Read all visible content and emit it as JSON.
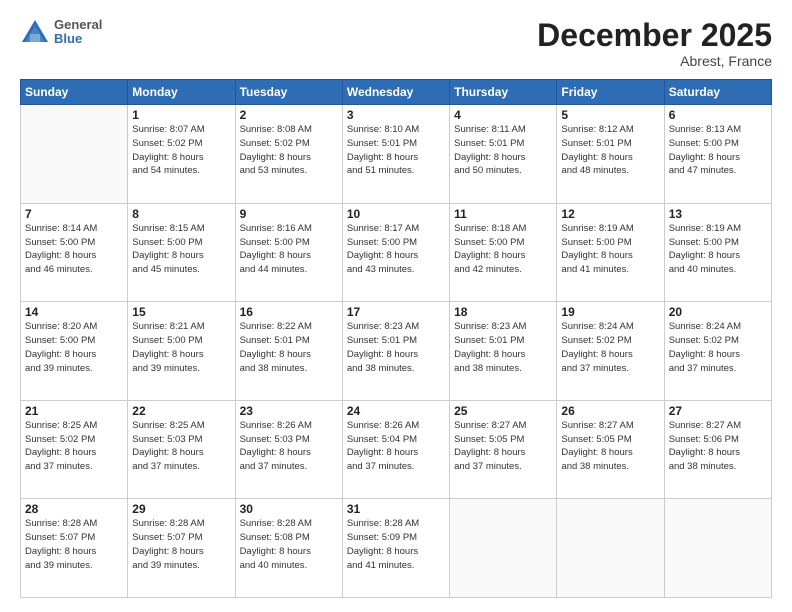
{
  "logo": {
    "general": "General",
    "blue": "Blue"
  },
  "title": "December 2025",
  "subtitle": "Abrest, France",
  "days_of_week": [
    "Sunday",
    "Monday",
    "Tuesday",
    "Wednesday",
    "Thursday",
    "Friday",
    "Saturday"
  ],
  "weeks": [
    [
      {
        "day": "",
        "sunrise": "",
        "sunset": "",
        "daylight": ""
      },
      {
        "day": "1",
        "sunrise": "Sunrise: 8:07 AM",
        "sunset": "Sunset: 5:02 PM",
        "daylight": "Daylight: 8 hours and 54 minutes."
      },
      {
        "day": "2",
        "sunrise": "Sunrise: 8:08 AM",
        "sunset": "Sunset: 5:02 PM",
        "daylight": "Daylight: 8 hours and 53 minutes."
      },
      {
        "day": "3",
        "sunrise": "Sunrise: 8:10 AM",
        "sunset": "Sunset: 5:01 PM",
        "daylight": "Daylight: 8 hours and 51 minutes."
      },
      {
        "day": "4",
        "sunrise": "Sunrise: 8:11 AM",
        "sunset": "Sunset: 5:01 PM",
        "daylight": "Daylight: 8 hours and 50 minutes."
      },
      {
        "day": "5",
        "sunrise": "Sunrise: 8:12 AM",
        "sunset": "Sunset: 5:01 PM",
        "daylight": "Daylight: 8 hours and 48 minutes."
      },
      {
        "day": "6",
        "sunrise": "Sunrise: 8:13 AM",
        "sunset": "Sunset: 5:00 PM",
        "daylight": "Daylight: 8 hours and 47 minutes."
      }
    ],
    [
      {
        "day": "7",
        "sunrise": "Sunrise: 8:14 AM",
        "sunset": "Sunset: 5:00 PM",
        "daylight": "Daylight: 8 hours and 46 minutes."
      },
      {
        "day": "8",
        "sunrise": "Sunrise: 8:15 AM",
        "sunset": "Sunset: 5:00 PM",
        "daylight": "Daylight: 8 hours and 45 minutes."
      },
      {
        "day": "9",
        "sunrise": "Sunrise: 8:16 AM",
        "sunset": "Sunset: 5:00 PM",
        "daylight": "Daylight: 8 hours and 44 minutes."
      },
      {
        "day": "10",
        "sunrise": "Sunrise: 8:17 AM",
        "sunset": "Sunset: 5:00 PM",
        "daylight": "Daylight: 8 hours and 43 minutes."
      },
      {
        "day": "11",
        "sunrise": "Sunrise: 8:18 AM",
        "sunset": "Sunset: 5:00 PM",
        "daylight": "Daylight: 8 hours and 42 minutes."
      },
      {
        "day": "12",
        "sunrise": "Sunrise: 8:19 AM",
        "sunset": "Sunset: 5:00 PM",
        "daylight": "Daylight: 8 hours and 41 minutes."
      },
      {
        "day": "13",
        "sunrise": "Sunrise: 8:19 AM",
        "sunset": "Sunset: 5:00 PM",
        "daylight": "Daylight: 8 hours and 40 minutes."
      }
    ],
    [
      {
        "day": "14",
        "sunrise": "Sunrise: 8:20 AM",
        "sunset": "Sunset: 5:00 PM",
        "daylight": "Daylight: 8 hours and 39 minutes."
      },
      {
        "day": "15",
        "sunrise": "Sunrise: 8:21 AM",
        "sunset": "Sunset: 5:00 PM",
        "daylight": "Daylight: 8 hours and 39 minutes."
      },
      {
        "day": "16",
        "sunrise": "Sunrise: 8:22 AM",
        "sunset": "Sunset: 5:01 PM",
        "daylight": "Daylight: 8 hours and 38 minutes."
      },
      {
        "day": "17",
        "sunrise": "Sunrise: 8:23 AM",
        "sunset": "Sunset: 5:01 PM",
        "daylight": "Daylight: 8 hours and 38 minutes."
      },
      {
        "day": "18",
        "sunrise": "Sunrise: 8:23 AM",
        "sunset": "Sunset: 5:01 PM",
        "daylight": "Daylight: 8 hours and 38 minutes."
      },
      {
        "day": "19",
        "sunrise": "Sunrise: 8:24 AM",
        "sunset": "Sunset: 5:02 PM",
        "daylight": "Daylight: 8 hours and 37 minutes."
      },
      {
        "day": "20",
        "sunrise": "Sunrise: 8:24 AM",
        "sunset": "Sunset: 5:02 PM",
        "daylight": "Daylight: 8 hours and 37 minutes."
      }
    ],
    [
      {
        "day": "21",
        "sunrise": "Sunrise: 8:25 AM",
        "sunset": "Sunset: 5:02 PM",
        "daylight": "Daylight: 8 hours and 37 minutes."
      },
      {
        "day": "22",
        "sunrise": "Sunrise: 8:25 AM",
        "sunset": "Sunset: 5:03 PM",
        "daylight": "Daylight: 8 hours and 37 minutes."
      },
      {
        "day": "23",
        "sunrise": "Sunrise: 8:26 AM",
        "sunset": "Sunset: 5:03 PM",
        "daylight": "Daylight: 8 hours and 37 minutes."
      },
      {
        "day": "24",
        "sunrise": "Sunrise: 8:26 AM",
        "sunset": "Sunset: 5:04 PM",
        "daylight": "Daylight: 8 hours and 37 minutes."
      },
      {
        "day": "25",
        "sunrise": "Sunrise: 8:27 AM",
        "sunset": "Sunset: 5:05 PM",
        "daylight": "Daylight: 8 hours and 37 minutes."
      },
      {
        "day": "26",
        "sunrise": "Sunrise: 8:27 AM",
        "sunset": "Sunset: 5:05 PM",
        "daylight": "Daylight: 8 hours and 38 minutes."
      },
      {
        "day": "27",
        "sunrise": "Sunrise: 8:27 AM",
        "sunset": "Sunset: 5:06 PM",
        "daylight": "Daylight: 8 hours and 38 minutes."
      }
    ],
    [
      {
        "day": "28",
        "sunrise": "Sunrise: 8:28 AM",
        "sunset": "Sunset: 5:07 PM",
        "daylight": "Daylight: 8 hours and 39 minutes."
      },
      {
        "day": "29",
        "sunrise": "Sunrise: 8:28 AM",
        "sunset": "Sunset: 5:07 PM",
        "daylight": "Daylight: 8 hours and 39 minutes."
      },
      {
        "day": "30",
        "sunrise": "Sunrise: 8:28 AM",
        "sunset": "Sunset: 5:08 PM",
        "daylight": "Daylight: 8 hours and 40 minutes."
      },
      {
        "day": "31",
        "sunrise": "Sunrise: 8:28 AM",
        "sunset": "Sunset: 5:09 PM",
        "daylight": "Daylight: 8 hours and 41 minutes."
      },
      {
        "day": "",
        "sunrise": "",
        "sunset": "",
        "daylight": ""
      },
      {
        "day": "",
        "sunrise": "",
        "sunset": "",
        "daylight": ""
      },
      {
        "day": "",
        "sunrise": "",
        "sunset": "",
        "daylight": ""
      }
    ]
  ]
}
